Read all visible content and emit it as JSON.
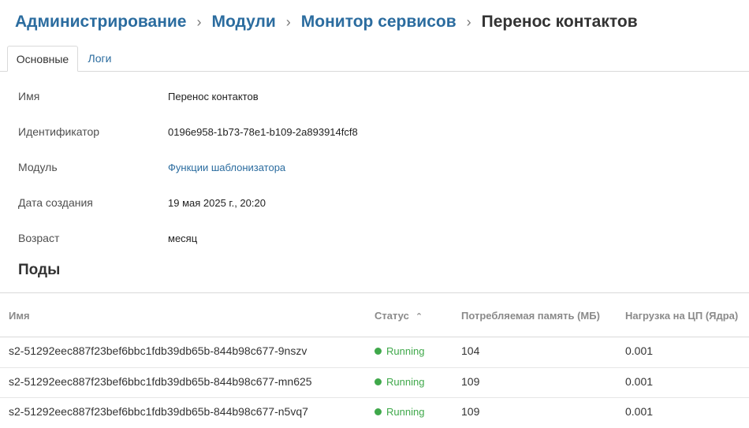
{
  "breadcrumb": {
    "items": [
      "Администрирование",
      "Модули",
      "Монитор сервисов"
    ],
    "current": "Перенос контактов",
    "separator": "›"
  },
  "tabs": [
    {
      "label": "Основные",
      "active": true
    },
    {
      "label": "Логи",
      "active": false
    }
  ],
  "properties": [
    {
      "label": "Имя",
      "value": "Перенос контактов"
    },
    {
      "label": "Идентификатор",
      "value": "0196e958-1b73-78e1-b109-2a893914fcf8"
    },
    {
      "label": "Модуль",
      "value": "Функции шаблонизатора"
    },
    {
      "label": "Дата создания",
      "value": "19 мая 2025 г., 20:20"
    },
    {
      "label": "Возраст",
      "value": "месяц"
    }
  ],
  "pods": {
    "title": "Поды",
    "columns": [
      "Имя",
      "Статус",
      "Потребляемая память (МБ)",
      "Нагрузка на ЦП (Ядра)"
    ],
    "sort_column": "Статус",
    "sort_direction": "asc",
    "rows": [
      {
        "name": "s2-51292eec887f23bef6bbc1fdb39db65b-844b98c677-9nszv",
        "status": "Running",
        "memory": "104",
        "cpu": "0.001"
      },
      {
        "name": "s2-51292eec887f23bef6bbc1fdb39db65b-844b98c677-mn625",
        "status": "Running",
        "memory": "109",
        "cpu": "0.001"
      },
      {
        "name": "s2-51292eec887f23bef6bbc1fdb39db65b-844b98c677-n5vq7",
        "status": "Running",
        "memory": "109",
        "cpu": "0.001"
      }
    ]
  },
  "colors": {
    "link": "#2b6c9f",
    "running": "#3fa84a",
    "border": "#d9d9d9"
  },
  "icons": {
    "breadcrumb_separator": "chevron-right-icon",
    "sort": "chevron-up-icon",
    "status": "status-dot-icon"
  }
}
